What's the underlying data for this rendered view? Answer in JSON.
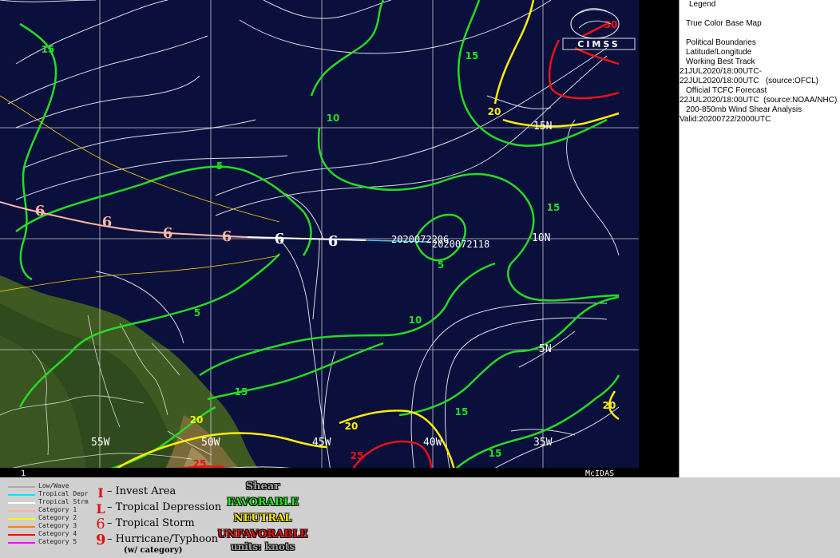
{
  "map": {
    "lat_labels": [
      "15N",
      "10N",
      "5N"
    ],
    "lon_labels": [
      "55W",
      "50W",
      "45W",
      "40W",
      "35W"
    ],
    "storm_labels": [
      "2020072206",
      "2020072118"
    ],
    "contour_labels": [
      "15",
      "15",
      "10",
      "5",
      "15",
      "5",
      "5",
      "10",
      "15",
      "15",
      "15",
      "20",
      "20",
      "20",
      "25",
      "25",
      "30",
      "20"
    ],
    "frame_number": "1",
    "mcidas": "McIDAS",
    "logo_text": "CIMSS"
  },
  "legend": {
    "title": "Legend",
    "items": [
      "True Color Base Map",
      "Political Boundaries",
      "Latitude/Longitude",
      "Working Best Track",
      "21JUL2020/18:00UTC-",
      "22JUL2020/18:00UTC   (source:OFCL)",
      "Official TCFC Forecast",
      "22JUL2020/18:00UTC  (source:NOAA/NHC)",
      "200-850mb Wind Shear Analysis",
      "Valid:20200722/2000UTC"
    ]
  },
  "track_key": [
    {
      "label": "Low/Wave",
      "color": "#aaaaaa"
    },
    {
      "label": "Tropical Depr",
      "color": "#00e5ff"
    },
    {
      "label": "Tropical Strm",
      "color": "#ffffff"
    },
    {
      "label": "Category 1",
      "color": "#ffb0a0"
    },
    {
      "label": "Category 2",
      "color": "#ffff00"
    },
    {
      "label": "Category 3",
      "color": "#ff8000"
    },
    {
      "label": "Category 4",
      "color": "#ff0000"
    },
    {
      "label": "Category 5",
      "color": "#ff00ff"
    }
  ],
  "symbol_key": {
    "invest_symbol": "I",
    "invest": "– Invest Area",
    "depression_symbol": "L",
    "depression": "– Tropical Depression",
    "storm_symbol": "6",
    "storm": "– Tropical Storm",
    "hurricane_symbol": "9",
    "hurricane": "– Hurricane/Typhoon",
    "category_note": "(w/ category)"
  },
  "shear_key": {
    "title": "Shear",
    "favorable": "FAVORABLE",
    "neutral": "NEUTRAL",
    "unfavorable": "UNFAVORABLE",
    "units": "units: knots"
  },
  "colors": {
    "ocean": "#0a0f3c",
    "favorable": "#22dd22",
    "neutral": "#ffee00",
    "unfavorable": "#ee1111",
    "grid": "#c8c8c8"
  }
}
